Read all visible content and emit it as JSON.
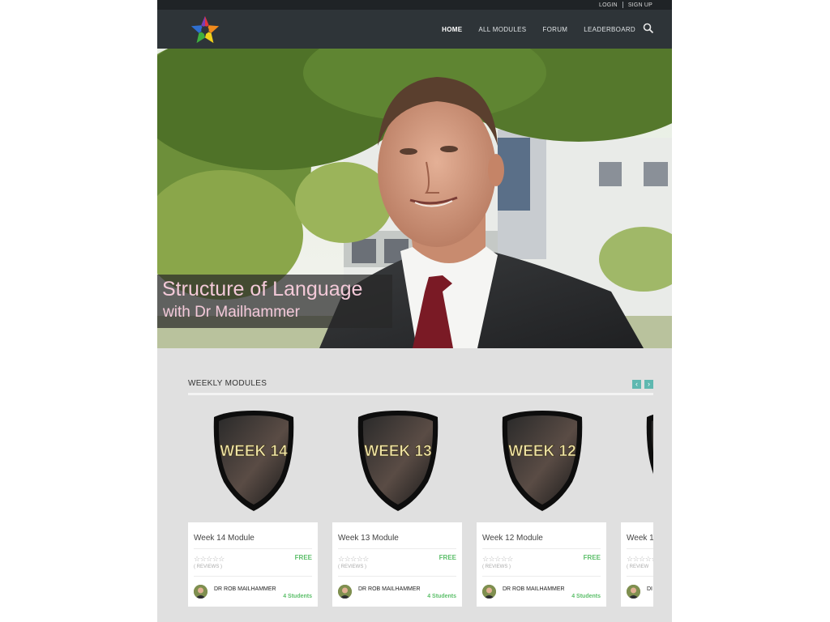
{
  "topbar": {
    "login": "LOGIN",
    "signup": "SIGN UP"
  },
  "nav": {
    "items": [
      {
        "label": "HOME",
        "active": true
      },
      {
        "label": "ALL MODULES",
        "active": false
      },
      {
        "label": "FORUM",
        "active": false
      },
      {
        "label": "LEADERBOARD",
        "active": false
      }
    ],
    "search_icon": "search-icon",
    "logo_icon": "rainbow-star-logo"
  },
  "hero": {
    "line1": "Structure of Language",
    "line2": "with Dr Mailhammer",
    "caption_color": "#f3c9d8"
  },
  "section": {
    "title": "WEEKLY MODULES",
    "prev_icon": "chevron-left-icon",
    "next_icon": "chevron-right-icon",
    "accent": "#5fb8b0"
  },
  "modules": [
    {
      "badge": "WEEK 14",
      "title": "Week 14 Module",
      "price": "FREE",
      "reviews": "( REVIEWS )",
      "instructor": "DR ROB MAILHAMMER",
      "students": "4 Students"
    },
    {
      "badge": "WEEK 13",
      "title": "Week 13 Module",
      "price": "FREE",
      "reviews": "( REVIEWS )",
      "instructor": "DR ROB MAILHAMMER",
      "students": "4 Students"
    },
    {
      "badge": "WEEK 12",
      "title": "Week 12 Module",
      "price": "FREE",
      "reviews": "( REVIEWS )",
      "instructor": "DR ROB MAILHAMMER",
      "students": "4 Students"
    },
    {
      "badge": "",
      "title": "Week 1",
      "price": "",
      "reviews": "( REVIEW",
      "instructor": "DI",
      "students": ""
    }
  ],
  "colors": {
    "price": "#5cbf6a",
    "nav_bg": "#2e3438",
    "topbar_bg": "#1f2326"
  }
}
